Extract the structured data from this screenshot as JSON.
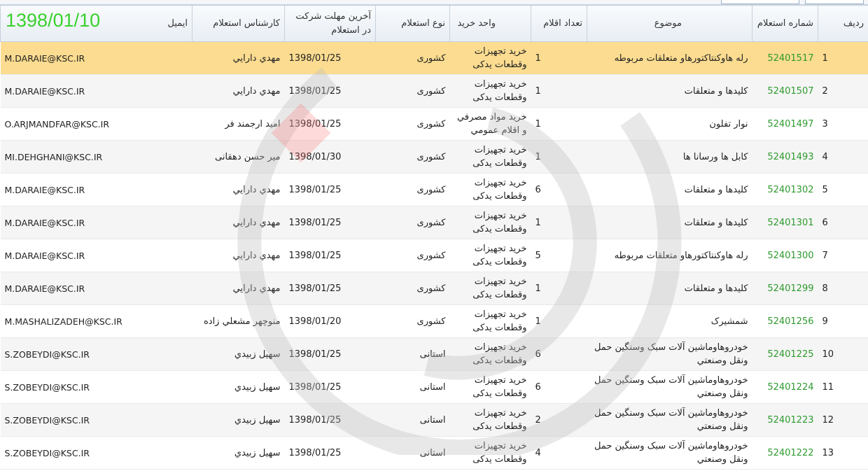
{
  "stamp_date": "1398/01/10",
  "columns": {
    "row": "ردیف",
    "number": "شماره استعلام",
    "subject": "موضوع",
    "count": "تعداد اقلام",
    "unit": "واحد خرید",
    "type": "نوع استعلام",
    "deadline": "آخرین مهلت شرکت در استعلام",
    "expert": "کارشناس استعلام",
    "email": "ایمیل"
  },
  "rows": [
    {
      "row": "1",
      "number": "52401517",
      "subject": "رله هاوکنتاکتورهاو متعلقات مربوطه",
      "count": "1",
      "unit": "خرید تجهیزات وقطعات یدکی",
      "type": "کشوری",
      "deadline": "1398/01/25",
      "expert": "مهدي دارايي",
      "email": "M.DARAIE@KSC.IR"
    },
    {
      "row": "2",
      "number": "52401507",
      "subject": "کلیدها و متعلقات",
      "count": "1",
      "unit": "خرید تجهیزات وقطعات یدکی",
      "type": "کشوری",
      "deadline": "1398/01/25",
      "expert": "مهدي دارايي",
      "email": "M.DARAIE@KSC.IR"
    },
    {
      "row": "3",
      "number": "52401497",
      "subject": "نوار تفلون",
      "count": "1",
      "unit": "خرید مواد مصرفي و اقلام عمومي",
      "type": "کشوری",
      "deadline": "1398/01/25",
      "expert": "امید ارجمند فر",
      "email": "O.ARJMANDFAR@KSC.IR"
    },
    {
      "row": "4",
      "number": "52401493",
      "subject": "کابل ها ورسانا ها",
      "count": "1",
      "unit": "خرید تجهیزات وقطعات یدکی",
      "type": "کشوری",
      "deadline": "1398/01/30",
      "expert": "میر حسن دهقانی",
      "email": "MI.DEHGHANI@KSC.IR"
    },
    {
      "row": "5",
      "number": "52401302",
      "subject": "کلیدها و متعلقات",
      "count": "6",
      "unit": "خرید تجهیزات وقطعات یدکی",
      "type": "کشوری",
      "deadline": "1398/01/25",
      "expert": "مهدي دارايي",
      "email": "M.DARAIE@KSC.IR"
    },
    {
      "row": "6",
      "number": "52401301",
      "subject": "کلیدها و متعلقات",
      "count": "1",
      "unit": "خرید تجهیزات وقطعات یدکی",
      "type": "کشوری",
      "deadline": "1398/01/25",
      "expert": "مهدي دارايي",
      "email": "M.DARAIE@KSC.IR"
    },
    {
      "row": "7",
      "number": "52401300",
      "subject": "رله هاوکنتاکتورهاو متعلقات مربوطه",
      "count": "5",
      "unit": "خرید تجهیزات وقطعات یدکی",
      "type": "کشوری",
      "deadline": "1398/01/25",
      "expert": "مهدي دارايي",
      "email": "M.DARAIE@KSC.IR"
    },
    {
      "row": "8",
      "number": "52401299",
      "subject": "کلیدها و متعلقات",
      "count": "1",
      "unit": "خرید تجهیزات وقطعات یدکی",
      "type": "کشوری",
      "deadline": "1398/01/25",
      "expert": "مهدي دارايي",
      "email": "M.DARAIE@KSC.IR"
    },
    {
      "row": "9",
      "number": "52401256",
      "subject": "شمشیرک",
      "count": "1",
      "unit": "خرید تجهیزات وقطعات یدکی",
      "type": "کشوری",
      "deadline": "1398/01/20",
      "expert": "منوچهر مشعلي زاده",
      "email": "M.MASHALIZADEH@KSC.IR"
    },
    {
      "row": "10",
      "number": "52401225",
      "subject": "خودروهاوماشین آلات سبک وسنگین حمل ونقل وصنعتي",
      "count": "6",
      "unit": "خرید تجهیزات وقطعات یدکی",
      "type": "استانی",
      "deadline": "1398/01/25",
      "expert": "سهیل زبیدي",
      "email": "S.ZOBEYDI@KSC.IR"
    },
    {
      "row": "11",
      "number": "52401224",
      "subject": "خودروهاوماشین آلات سبک وسنگین حمل ونقل وصنعتي",
      "count": "6",
      "unit": "خرید تجهیزات وقطعات یدکی",
      "type": "استانی",
      "deadline": "1398/01/25",
      "expert": "سهیل زبیدي",
      "email": "S.ZOBEYDI@KSC.IR"
    },
    {
      "row": "12",
      "number": "52401223",
      "subject": "خودروهاوماشین آلات سبک وسنگین حمل ونقل وصنعتي",
      "count": "2",
      "unit": "خرید تجهیزات وقطعات یدکی",
      "type": "استانی",
      "deadline": "1398/01/25",
      "expert": "سهیل زبیدي",
      "email": "S.ZOBEYDI@KSC.IR"
    },
    {
      "row": "13",
      "number": "52401222",
      "subject": "خودروهاوماشین آلات سبک وسنگین حمل ونقل وصنعتي",
      "count": "4",
      "unit": "خرید تجهیزات وقطعات یدکی",
      "type": "استانی",
      "deadline": "1398/01/25",
      "expert": "سهیل زبیدي",
      "email": "S.ZOBEYDI@KSC.IR"
    }
  ],
  "selected_row": "1",
  "colors": {
    "selected_row": "#fbdc90",
    "inquiry_number": "#2e9a2e",
    "stamp": "#3ad12e",
    "alt_row": "#f5f5f5"
  }
}
